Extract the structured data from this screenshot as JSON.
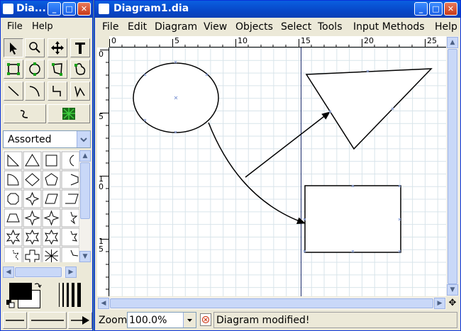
{
  "toolbox": {
    "title": "Dia...",
    "menu": [
      "File",
      "Help"
    ],
    "sheet_select": "Assorted"
  },
  "main": {
    "title": "Diagram1.dia",
    "menu": [
      "File",
      "Edit",
      "Diagram",
      "View",
      "Objects",
      "Select",
      "Tools",
      "Input Methods",
      "Help"
    ],
    "ruler_h": [
      "0",
      "5",
      "10",
      "15",
      "20",
      "25"
    ],
    "ruler_v": [
      [
        "0"
      ],
      [
        "5"
      ],
      [
        "1",
        "0"
      ],
      [
        "1",
        "5"
      ]
    ],
    "zoom_label": "Zoom",
    "zoom_value": "100.0%",
    "status": "Diagram modified!"
  }
}
